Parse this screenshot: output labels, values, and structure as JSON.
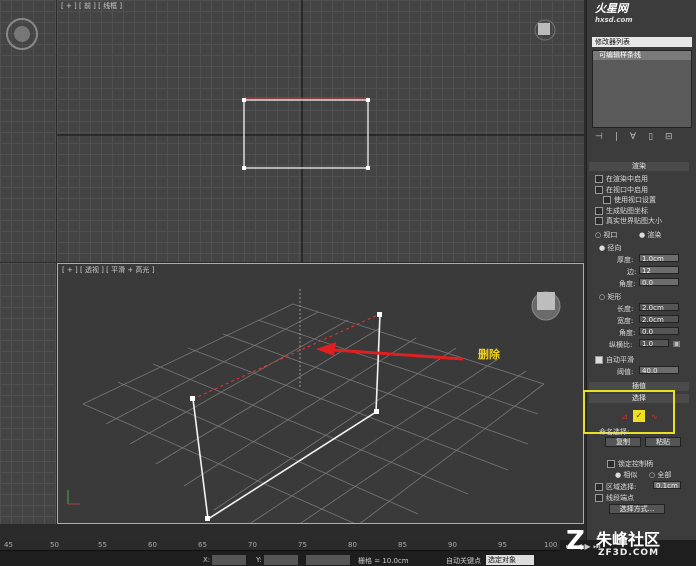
{
  "viewports": {
    "top_left_label": "[ + ] [ 前 ] [ 线框 ]",
    "persp_label": "[ + ] [ 透视 ] [ 平滑 + 高光 ]"
  },
  "annotation": {
    "text": "删除",
    "arrow_color": "#e02020",
    "text_color": "#f0d020"
  },
  "logo": {
    "text": "火星网",
    "sub": "hxsd.com"
  },
  "panel": {
    "modifier_list": "修改器列表",
    "stack_item": "可编辑样条线",
    "rollout_render": "渲染",
    "enable_render": "在渲染中启用",
    "enable_viewport": "在视口中启用",
    "use_viewport_settings": "使用视口设置",
    "gen_mapping": "生成贴图坐标",
    "real_world": "真实世界贴图大小",
    "viewport_radio": "视口",
    "render_radio": "渲染",
    "radial": "径向",
    "thickness_label": "厚度:",
    "thickness_value": "1.0cm",
    "sides_label": "边:",
    "sides_value": "12",
    "angle_label": "角度:",
    "angle_value": "0.0",
    "rectangular": "矩形",
    "length_label": "长度:",
    "length_value": "2.0cm",
    "width_label": "宽度:",
    "width_value": "2.0cm",
    "angle2_label": "角度:",
    "angle2_value": "0.0",
    "aspect_label": "纵横比:",
    "aspect_value": "1.0",
    "auto_smooth": "自动平滑",
    "threshold_label": "阈值:",
    "threshold_value": "40.0",
    "rollout_interp": "插值",
    "rollout_select": "选择",
    "named_sel": "命名选择:",
    "copy_btn": "复制",
    "paste_btn": "粘贴",
    "lock_handles": "锁定控制柄",
    "similar": "相似",
    "all": "全部",
    "area_sel": "区域选择:",
    "area_value": "0.1cm",
    "seg_end": "线段端点",
    "sel_method": "选择方式..."
  },
  "status": {
    "ticks": [
      "45",
      "50",
      "55",
      "60",
      "65",
      "70",
      "75",
      "80",
      "85",
      "90",
      "95",
      "100"
    ],
    "x_label": "X:",
    "y_label": "Y:",
    "grid": "栅格 = 10.0cm",
    "auto_key": "自动关键点",
    "sel_set": "选定对象"
  },
  "watermark": {
    "text": "朱峰社区",
    "sub": "ZF3D.COM"
  }
}
